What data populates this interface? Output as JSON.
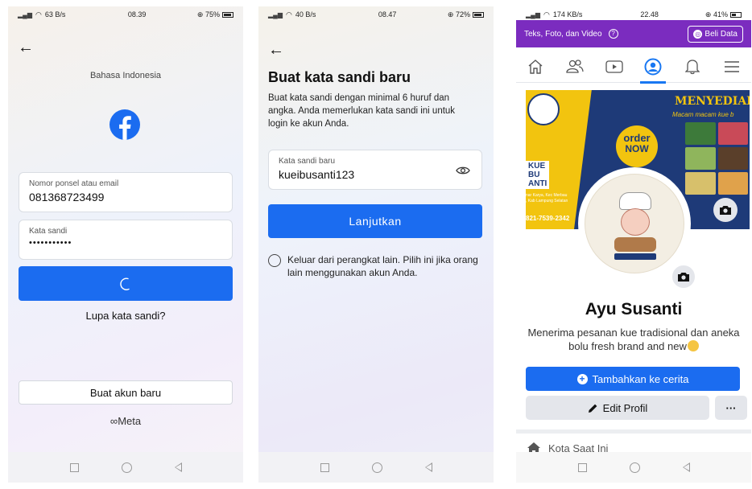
{
  "phone1": {
    "status": {
      "net": "63 B/s",
      "time": "08.39",
      "battery": "75%"
    },
    "language": "Bahasa Indonesia",
    "phone_label": "Nomor ponsel atau email",
    "phone_value": "081368723499",
    "password_label": "Kata sandi",
    "password_value": "•••••••••••",
    "forgot": "Lupa kata sandi?",
    "create": "Buat akun baru",
    "meta": "Meta"
  },
  "phone2": {
    "status": {
      "net": "40 B/s",
      "time": "08.47",
      "battery": "72%"
    },
    "title": "Buat kata sandi baru",
    "description": "Buat kata sandi dengan minimal 6 huruf dan angka. Anda memerlukan kata sandi ini untuk login ke akun Anda.",
    "new_password_label": "Kata sandi baru",
    "new_password_value": "kueibusanti123",
    "continue": "Lanjutkan",
    "logout_option": "Keluar dari perangkat lain. Pilih ini jika orang lain menggunakan akun Anda."
  },
  "phone3": {
    "status": {
      "net": "174 KB/s",
      "time": "22.48",
      "battery": "41%"
    },
    "data_banner": "Teks, Foto, dan Video",
    "buy_data": "Beli Data",
    "cover": {
      "headline": "MENYEDIAK",
      "subline": "Macam macam kue b",
      "order": "order",
      "now": "NOW",
      "brand_lines": [
        "KUE",
        "BU",
        "ANTI"
      ],
      "address": "nar Karya, Kec Merbau\n, Kab Lampung Selatan",
      "phone": "821-7539-2342"
    },
    "profile_name": "Ayu Susanti",
    "bio": "Menerima pesanan kue tradisional dan aneka bolu fresh brand and new",
    "add_story": "Tambahkan ke cerita",
    "edit_profile": "Edit Profil",
    "more": "···",
    "current_city": "Kota Saat Ini"
  },
  "colors": {
    "fb_blue": "#1b6cf0",
    "purple_banner": "#7b2cbf"
  }
}
